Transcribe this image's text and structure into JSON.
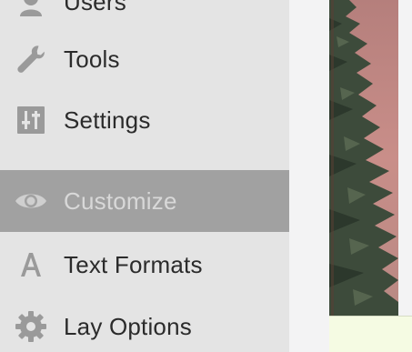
{
  "sidebar": {
    "items": [
      {
        "label": "Users",
        "icon": "users-icon"
      },
      {
        "label": "Tools",
        "icon": "wrench-icon"
      },
      {
        "label": "Settings",
        "icon": "settings-sliders-icon"
      },
      {
        "label": "Customize",
        "icon": "eye-icon",
        "active": true
      },
      {
        "label": "Text Formats",
        "icon": "letter-a-icon"
      },
      {
        "label": "Lay Options",
        "icon": "gear-icon"
      }
    ]
  },
  "colors": {
    "sidebar_bg": "#e4e4e4",
    "active_bg": "#a1a1a1",
    "active_text": "#d8d8d8",
    "icon_gray": "#9a9a9a",
    "preview_sky": "#c68c87",
    "foliage": "#3a4a3a",
    "bottom_strip": "#f5fbe3"
  }
}
